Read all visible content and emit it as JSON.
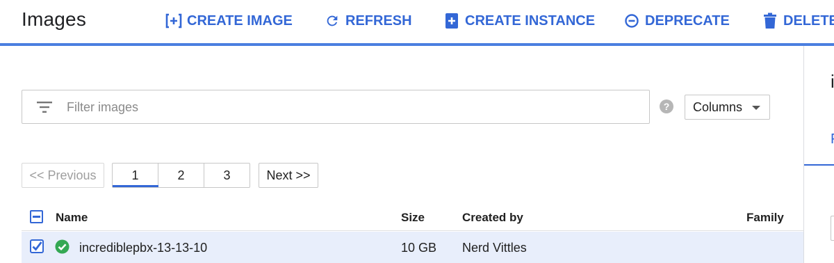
{
  "header": {
    "title": "Images",
    "actions": [
      {
        "label": "CREATE IMAGE",
        "icon": "create-image-icon"
      },
      {
        "label": "REFRESH",
        "icon": "refresh-icon"
      },
      {
        "label": "CREATE INSTANCE",
        "icon": "create-instance-icon"
      },
      {
        "label": "DEPRECATE",
        "icon": "deprecate-icon"
      },
      {
        "label": "DELETE",
        "icon": "trash-icon"
      }
    ],
    "accent_color": "#3367d6"
  },
  "filter": {
    "placeholder": "Filter images",
    "value": "",
    "help_icon": "help-icon",
    "columns_label": "Columns"
  },
  "pagination": {
    "previous_label": "<< Previous",
    "pages": [
      "1",
      "2",
      "3"
    ],
    "current_page": "1",
    "next_label": "Next >>"
  },
  "table": {
    "columns": [
      "Name",
      "Size",
      "Created by",
      "Family"
    ],
    "rows": [
      {
        "selected": true,
        "status": "ok",
        "name": "incrediblepbx-13-13-10",
        "size": "10 GB",
        "created_by": "Nerd Vittles",
        "family": ""
      }
    ]
  },
  "side_panel": {
    "title_fragment": "i",
    "tab_fragment": "F"
  }
}
